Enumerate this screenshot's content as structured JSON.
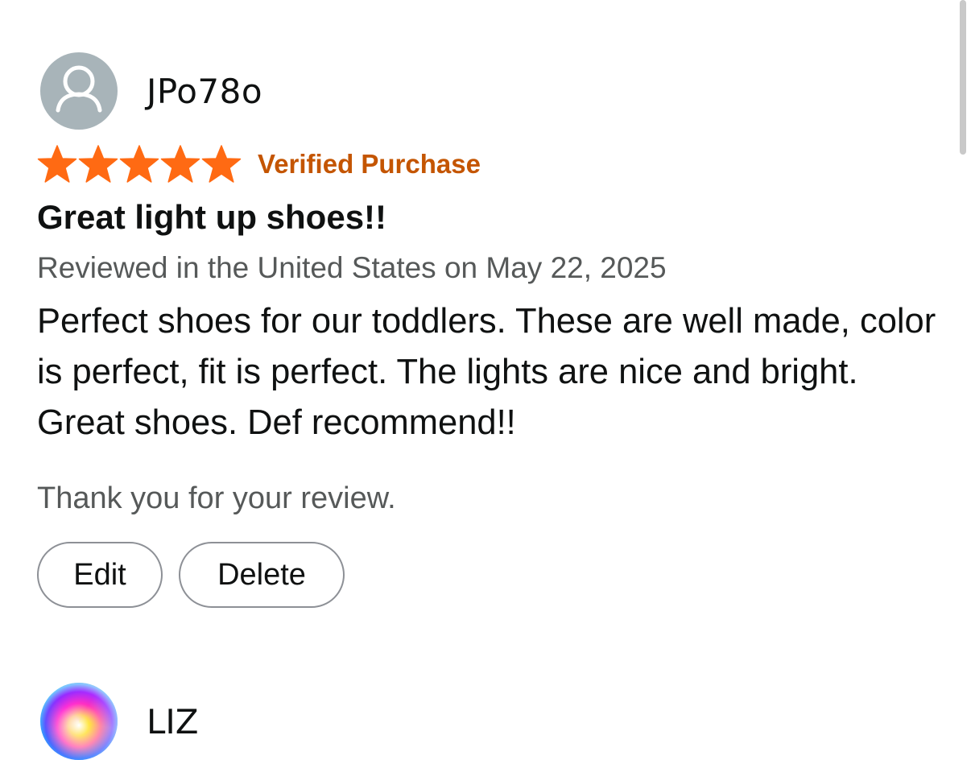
{
  "reviews": [
    {
      "profile_name": "JPo78o",
      "rating": 5,
      "rating_max": 5,
      "verified_label": "Verified Purchase",
      "title": "Great light up shoes!!",
      "date": "Reviewed in the United States on May 22, 2025",
      "body": "Perfect shoes for our toddlers. These are well made, color is perfect, fit is perfect. The lights are nice and bright. Great shoes. Def recommend!!",
      "thank_you": "Thank you for your review.",
      "edit_label": "Edit",
      "delete_label": "Delete"
    },
    {
      "profile_name": "LIZ"
    }
  ],
  "icons": {
    "avatar_placeholder": "user-silhouette-icon",
    "star": "star-icon"
  },
  "colors": {
    "star": "#ff6a13",
    "verified": "#c45500",
    "secondary_text": "#565959",
    "avatar_bg": "#a8b4b9"
  }
}
